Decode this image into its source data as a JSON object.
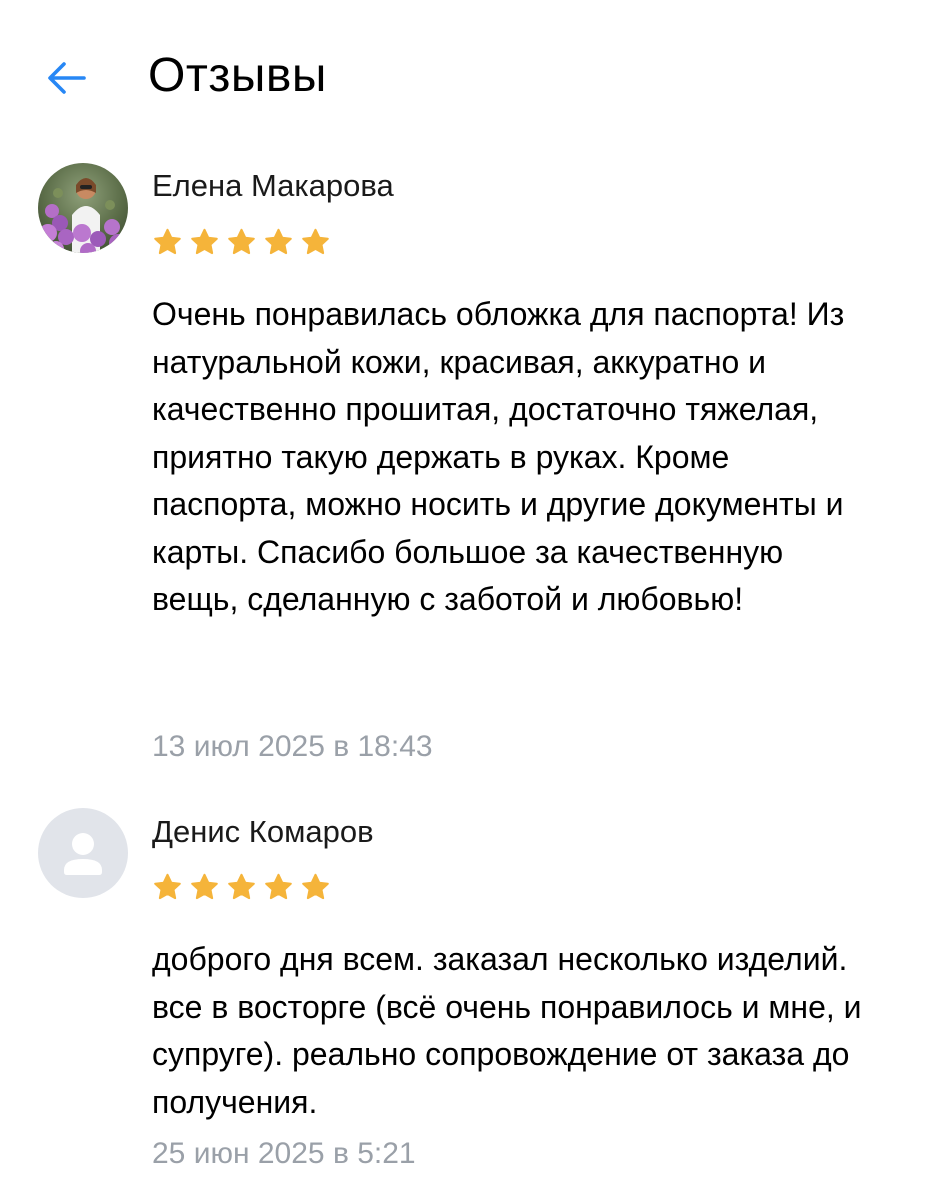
{
  "header": {
    "title": "Отзывы",
    "back_icon": "arrow-left-icon",
    "accent_color": "#2787f5"
  },
  "reviews": [
    {
      "author": "Елена Макарова",
      "avatar": "photo-avatar",
      "rating": 5,
      "rating_max": 5,
      "text": "Очень понравилась обложка для паспорта! Из натуральной кожи, красивая, аккуратно и качественно прошитая, достаточно тяжелая, приятно такую держать в руках. Кроме паспорта, можно носить и другие документы и карты. Спасибо большое за качественную вещь, сделанную с заботой и любовью!",
      "date": "13 июл 2025 в 18:43"
    },
    {
      "author": "Денис Комаров",
      "avatar": "user-placeholder-icon",
      "rating": 5,
      "rating_max": 5,
      "text": "доброго дня всем. заказал несколько изделий. все в восторге (всё очень понравилось и мне, и супруге). реально сопровождение от заказа до получения.",
      "date": "25 июн 2025 в 5:21"
    }
  ],
  "colors": {
    "star": "#f5b43a",
    "date_text": "#9aa0a8",
    "placeholder_avatar_bg": "#e1e4ea",
    "placeholder_avatar_fg": "#ffffff"
  }
}
